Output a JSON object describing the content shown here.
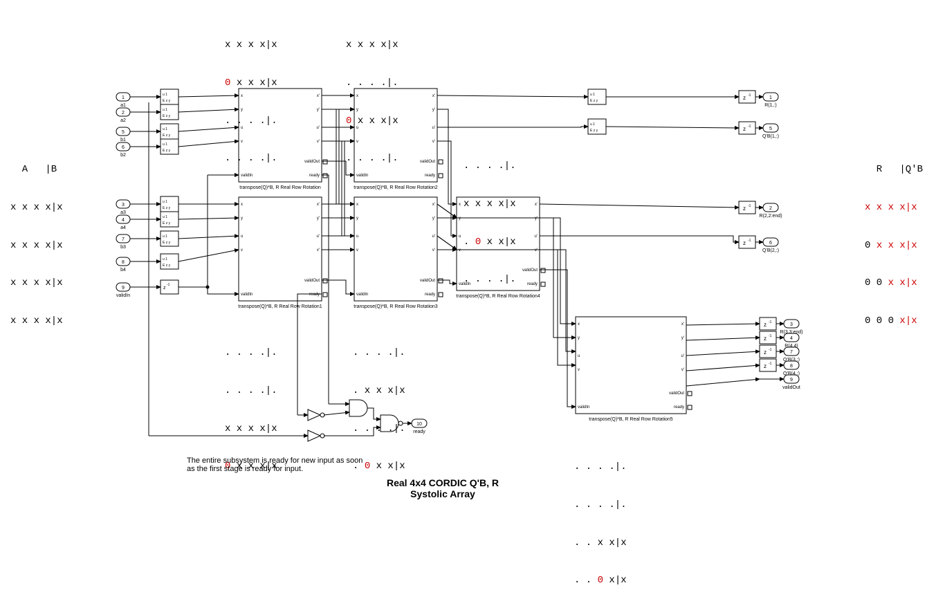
{
  "title_line1": "Real 4x4 CORDIC Q'B, R",
  "title_line2": "Systolic Array",
  "note_line1": "The entire subsystem is ready for new input as soon",
  "note_line2": "as the first stage is ready for input.",
  "left_header": "  A   |B",
  "left_row1": "x x x x|x",
  "left_row2": "x x x x|x",
  "left_row3": "x x x x|x",
  "left_row4": "x x x x|x",
  "right_header": "  R   |Q'B",
  "right_row1_a": "x x x x|",
  "right_row1_b": "x",
  "right_row2_a": "0 ",
  "right_row2_b": "x x x|",
  "right_row2_c": "x",
  "right_row3_a": "0 0 ",
  "right_row3_b": "x x|",
  "right_row3_c": "x",
  "right_row4_a": "0 0 0 ",
  "right_row4_b": "x|",
  "right_row4_c": "x",
  "top1_row1": "x x x x|x",
  "top1_row2_a": "0 ",
  "top1_row2_b": "x x x|x",
  "top1_row3": ". . . .|.",
  "top1_row4": ". . . .|.",
  "top2_row1": "x x x x|x",
  "top2_row2": ". . . .|.",
  "top2_row3_a": "0 ",
  "top2_row3_b": "x x x|x",
  "top2_row4": ". . . .|.",
  "mid_row1": ". . . .|.",
  "mid_row2": "x x x x|x",
  "mid_row3_a": ". ",
  "mid_row3_b": "0 ",
  "mid_row3_c": "x x|x",
  "mid_row4": ". . . .|.",
  "below1_row1": ". . . .|.",
  "below1_row2": ". . . .|.",
  "below1_row3": "x x x x|x",
  "below1_row4_a": "0 ",
  "below1_row4_b": "x x x|x",
  "below2_row1": ". . . .|.",
  "below2_row2": ". x x x|x",
  "below2_row3": ". . . .|.",
  "below2_row4_a": ". ",
  "below2_row4_b": "0 ",
  "below2_row4_c": "x x|x",
  "below3_row1": ". . . .|.",
  "below3_row2": ". . . .|.",
  "below3_row3": ". . x x|x",
  "below3_row4_a": ". . ",
  "below3_row4_b": "0 ",
  "below3_row4_c": "x|x",
  "in_ports": [
    "a1",
    "a2",
    "b1",
    "b2",
    "a3",
    "a4",
    "b3",
    "b4",
    "validIn"
  ],
  "in_nums": [
    "1",
    "2",
    "5",
    "6",
    "3",
    "4",
    "7",
    "8",
    "9"
  ],
  "out_ports": [
    "R(1,:)",
    "Q'B(1,:)",
    "R(2,2:end)",
    "Q'B(2,:)",
    "R(3,3:end)",
    "R(4,4)",
    "Q'B(3,:)",
    "Q'B(4,:)",
    "validOut",
    "ready"
  ],
  "out_nums": [
    "1",
    "5",
    "2",
    "6",
    "3",
    "4",
    "7",
    "8",
    "9",
    "10"
  ],
  "blk_name0": "transpose(Q)*B, R Real Row Rotation",
  "blk_name1": "transpose(Q)*B, R Real Row Rotation1",
  "blk_name2": "transpose(Q)*B, R Real Row Rotation2",
  "blk_name3": "transpose(Q)*B, R Real Row Rotation3",
  "blk_name4": "transpose(Q)*B, R Real Row Rotation4",
  "blk_name5": "transpose(Q)*B, R Real Row Rotation5",
  "port_x": "x",
  "port_y": "y",
  "port_u": "u",
  "port_v": "v",
  "port_xo": "x'",
  "port_yo": "y'",
  "port_uo": "u'",
  "port_vo": "v'",
  "port_validIn": "validIn",
  "port_validOut": "validOut",
  "port_ready": "ready",
  "enabled_label": "u 1\nE z y",
  "z_label": "z-1"
}
